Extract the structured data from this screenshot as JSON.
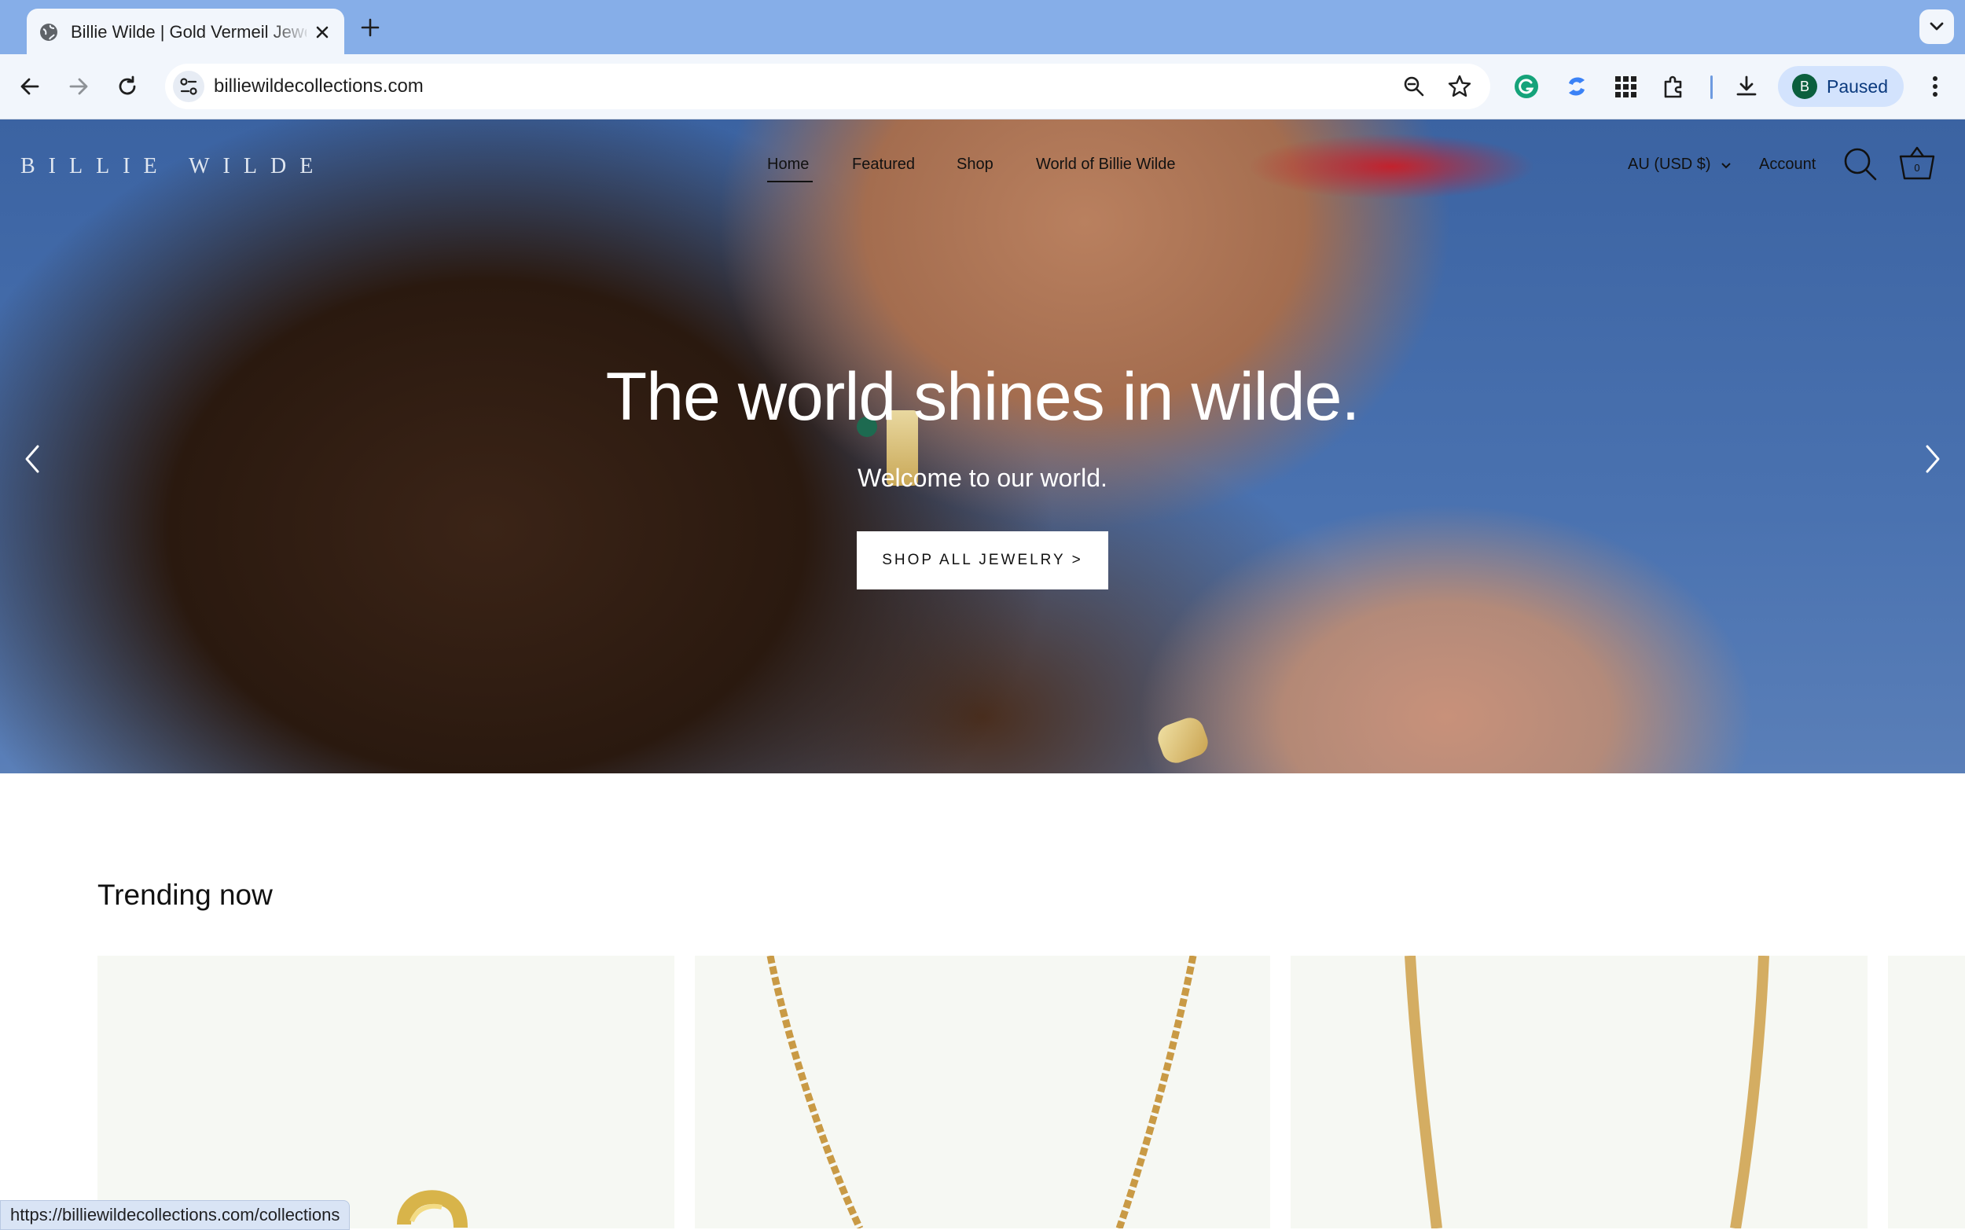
{
  "browser": {
    "tab_title": "Billie Wilde | Gold Vermeil Jewelry",
    "url": "billiewildecollections.com",
    "profile_initial": "B",
    "profile_status": "Paused",
    "status_url": "https://billiewildecollections.com/collections"
  },
  "site": {
    "logo": "BILLIE WILDE",
    "nav": [
      "Home",
      "Featured",
      "Shop",
      "World of Billie Wilde"
    ],
    "currency": "AU (USD $)",
    "account": "Account",
    "cart_count": "0"
  },
  "hero": {
    "title": "The world shines in wilde.",
    "subtitle": "Welcome to our world.",
    "button": "SHOP ALL JEWELRY >"
  },
  "trending": {
    "heading": "Trending now",
    "products": [
      {
        "type": "huggie-earrings"
      },
      {
        "type": "rope-chain-necklace"
      },
      {
        "type": "herringbone-chain-necklace"
      }
    ]
  },
  "colors": {
    "tabbar": "#86aee8",
    "toolbar": "#f2f6fc",
    "sky": "#4a72b0",
    "gold": "#c9a24f"
  }
}
